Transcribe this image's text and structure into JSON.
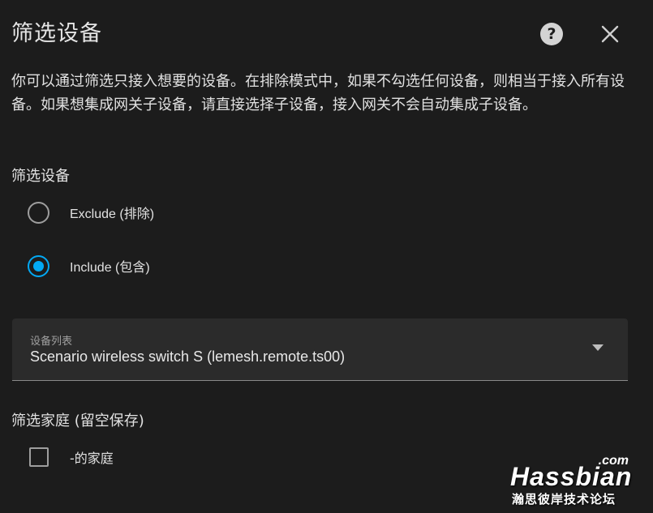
{
  "header": {
    "title": "筛选设备",
    "help_label": "?",
    "close_label": "×"
  },
  "description": "你可以通过筛选只接入想要的设备。在排除模式中，如果不勾选任何设备，则相当于接入所有设备。如果想集成网关子设备，请直接选择子设备，接入网关不会自动集成子设备。",
  "device_filter": {
    "title": "筛选设备",
    "options": [
      {
        "label": "Exclude (排除)",
        "checked": false
      },
      {
        "label": "Include (包含)",
        "checked": true
      }
    ]
  },
  "device_list": {
    "label": "设备列表",
    "value": "Scenario wireless switch S (lemesh.remote.ts00)"
  },
  "home_filter": {
    "title": "筛选家庭 (留空保存)",
    "homes": [
      {
        "label": "-的家庭",
        "checked": false
      }
    ]
  },
  "watermark": {
    "suffix": ".com",
    "brand": "Hassbian",
    "subtitle": "瀚思彼岸技术论坛"
  },
  "colors": {
    "background": "#1c1c1c",
    "accent": "#03a9f4",
    "field_background": "#2b2b2b"
  },
  "icons": {
    "help": "help-circle-icon",
    "close": "close-icon",
    "dropdown": "chevron-down-icon"
  }
}
